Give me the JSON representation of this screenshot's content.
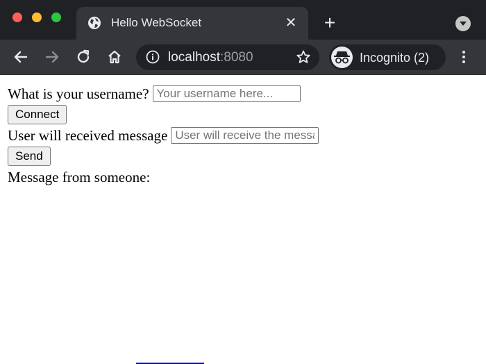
{
  "browser": {
    "tab": {
      "title": "Hello WebSocket"
    },
    "address": {
      "host": "localhost",
      "port": ":8080"
    },
    "profile": {
      "label": "Incognito (2)"
    },
    "colors": {
      "chrome_dark": "#202124",
      "toolbar": "#35363a",
      "text": "#e8eaed"
    }
  },
  "page": {
    "username_label": "What is your username?",
    "username_placeholder": "Your username here...",
    "connect_label": "Connect",
    "recipient_label": "User will received message",
    "recipient_placeholder": "User will receive the message",
    "send_label": "Send",
    "message_header": "Message from someone:"
  }
}
